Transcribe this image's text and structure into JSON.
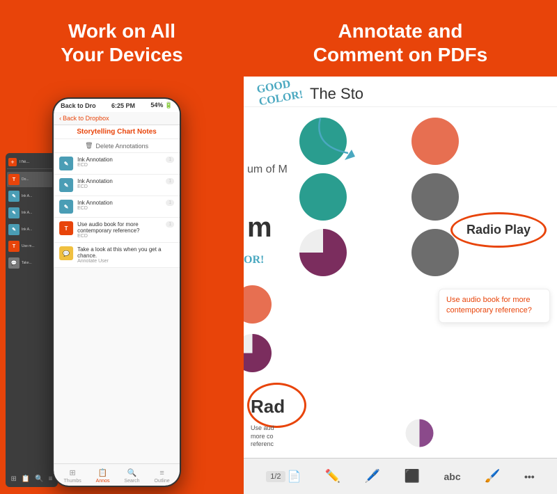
{
  "left": {
    "title_line1": "Work on All",
    "title_line2": "Your Devices",
    "phone": {
      "status_time": "6:25 PM",
      "status_battery": "54%",
      "nav_back": "Back to Dropbox",
      "screen_title": "Storytelling Chart Notes",
      "delete_button": "Delete Annotations",
      "annotations": [
        {
          "type": "ink",
          "title": "Ink Annotation",
          "sub": "ECD"
        },
        {
          "type": "ink",
          "title": "Ink Annotation",
          "sub": "ECD"
        },
        {
          "type": "ink",
          "title": "Ink Annotation",
          "sub": "ECD"
        },
        {
          "type": "text",
          "title": "Use audio book for more contemporary reference?",
          "sub": "ECD"
        },
        {
          "type": "note",
          "title": "Take a look at this when you get a chance.",
          "sub": "Annotate User"
        }
      ],
      "toolbar": [
        {
          "label": "Thumbs",
          "active": false
        },
        {
          "label": "Annos",
          "active": true
        },
        {
          "label": "Search",
          "active": false
        },
        {
          "label": "Outline",
          "active": false
        }
      ]
    },
    "tablet": {
      "items": [
        {
          "label": "The...",
          "type": "orange"
        },
        {
          "label": "Do...",
          "type": "orange"
        },
        {
          "label": "Ink A...",
          "type": "blue"
        },
        {
          "label": "Ink A...",
          "type": "blue"
        },
        {
          "label": "Ink A...",
          "type": "blue"
        },
        {
          "label": "Use m...",
          "type": "orange"
        },
        {
          "label": "Take...",
          "type": "orange"
        }
      ]
    }
  },
  "right": {
    "title_line1": "Annotate and",
    "title_line2": "Comment on PDFs",
    "pdf": {
      "title": "The Sto",
      "page_indicator": "1/2",
      "handwriting": "GOOD\nCOLOR!",
      "radio_play_label": "Radio Play",
      "annotation_text": "Use audio book for more contemporary reference?",
      "bottom_partial_text": "Rad",
      "use_audio_text": "Use aud\nmore co\nreferenc",
      "circles": [
        {
          "color": "teal",
          "label": "teal-circle-1"
        },
        {
          "color": "orange",
          "label": "orange-circle"
        },
        {
          "color": "teal",
          "label": "teal-circle-2"
        },
        {
          "color": "gray",
          "label": "gray-circle-1"
        },
        {
          "color": "purple-pie",
          "label": "purple-pie-circle"
        },
        {
          "color": "gray",
          "label": "gray-circle-2"
        }
      ],
      "toolbar_items": [
        {
          "icon": "📄",
          "label": "page"
        },
        {
          "icon": "✏️",
          "label": "pencil"
        },
        {
          "icon": "🖊️",
          "label": "pen"
        },
        {
          "icon": "⬛",
          "label": "highlight"
        },
        {
          "icon": "abc",
          "label": "text"
        },
        {
          "icon": "🖌️",
          "label": "brush"
        },
        {
          "icon": "•••",
          "label": "more"
        }
      ]
    }
  }
}
